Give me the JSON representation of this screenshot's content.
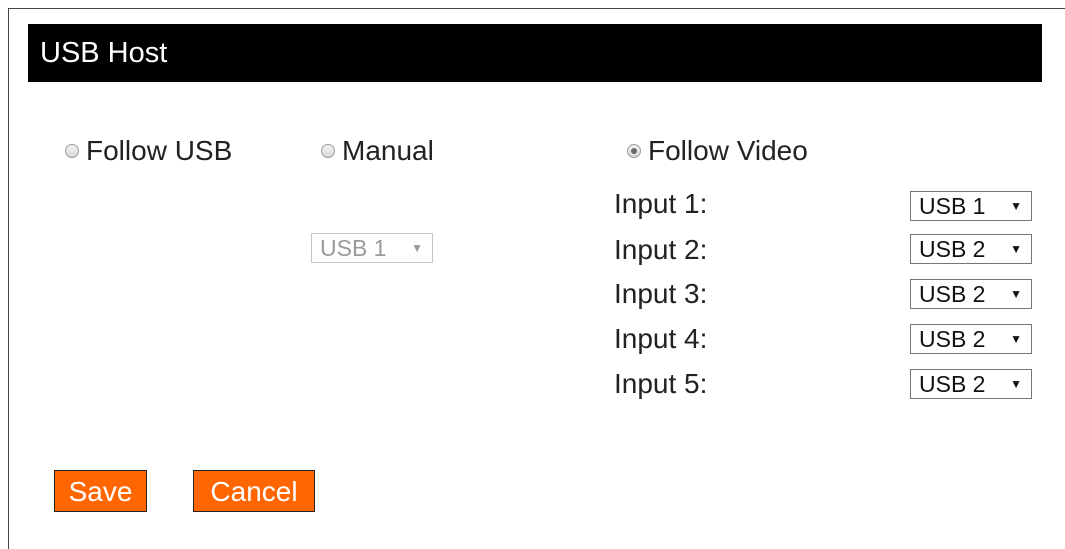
{
  "header": {
    "title": "USB Host"
  },
  "modes": {
    "follow_usb": {
      "label": "Follow USB",
      "checked": false
    },
    "manual": {
      "label": "Manual",
      "checked": false
    },
    "follow_video": {
      "label": "Follow Video",
      "checked": true
    }
  },
  "manual_select": {
    "value": "USB 1",
    "disabled": true
  },
  "inputs": [
    {
      "label": "Input 1:",
      "value": "USB 1"
    },
    {
      "label": "Input 2:",
      "value": "USB 2"
    },
    {
      "label": "Input 3:",
      "value": "USB 2"
    },
    {
      "label": "Input 4:",
      "value": "USB 2"
    },
    {
      "label": "Input 5:",
      "value": "USB 2"
    }
  ],
  "icons": {
    "dropdown": "triangle-down-icon"
  },
  "actions": {
    "save_label": "Save",
    "cancel_label": "Cancel"
  },
  "colors": {
    "header_bg": "#000000",
    "button_bg": "#ff6600"
  }
}
